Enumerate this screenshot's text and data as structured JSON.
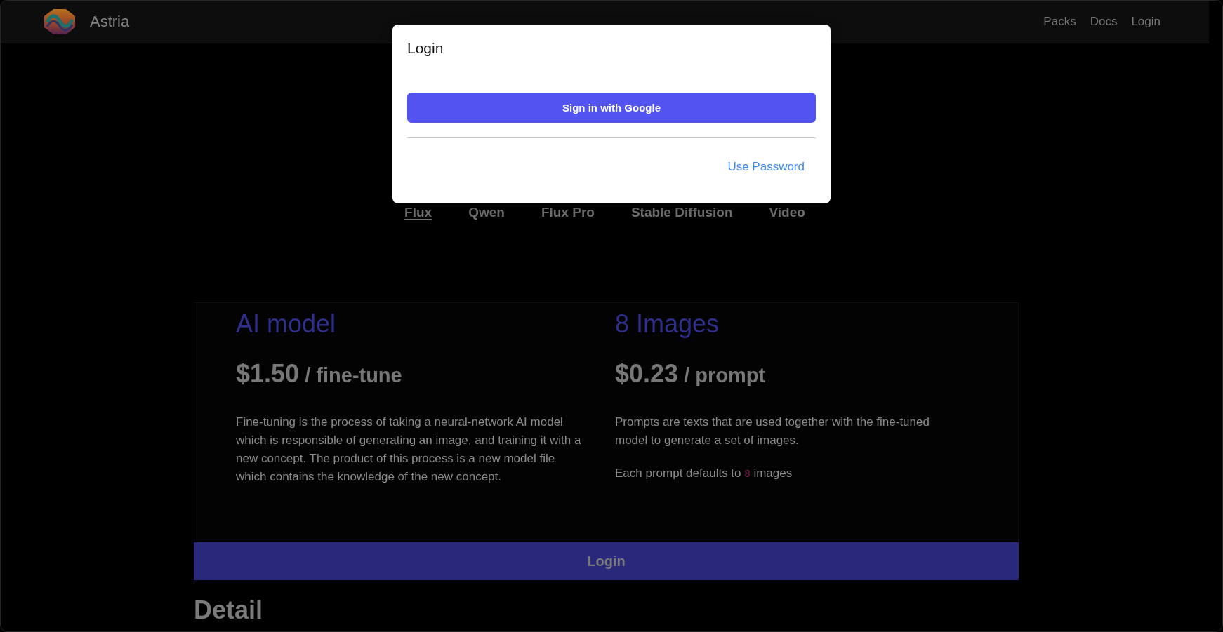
{
  "navbar": {
    "brand": "Astria",
    "links": [
      "Packs",
      "Docs",
      "Login"
    ]
  },
  "login_modal": {
    "title": "Login",
    "google_button": "Sign in with Google",
    "password_link": "Use Password"
  },
  "model_tabs": [
    {
      "label": "Flux",
      "selected": true
    },
    {
      "label": "Qwen",
      "selected": false
    },
    {
      "label": "Flux Pro",
      "selected": false
    },
    {
      "label": "Stable Diffusion",
      "selected": false
    },
    {
      "label": "Video",
      "selected": false
    }
  ],
  "pricing": {
    "columns": [
      {
        "title": "AI model",
        "price": "$1.50",
        "unit": "/ fine-tune",
        "paragraphs": [
          {
            "segments": [
              {
                "kind": "text",
                "text": "Fine-tuning is the process of taking a neural-network AI model which is responsible of generating an image, and training it with a new concept. The product of this process is a new model file which contains the knowledge of the new concept."
              }
            ]
          }
        ]
      },
      {
        "title": "8 Images",
        "price": "$0.23",
        "unit": "/ prompt",
        "paragraphs": [
          {
            "segments": [
              {
                "kind": "text",
                "text": "Prompts are texts that are used together with the fine-tuned model to generate a set of images."
              }
            ]
          },
          {
            "segments": [
              {
                "kind": "text",
                "text": "Each prompt defaults to "
              },
              {
                "kind": "code",
                "text": "8"
              },
              {
                "kind": "text",
                "text": " images"
              }
            ]
          }
        ]
      }
    ],
    "login_button": "Login"
  },
  "details_heading": "Detail"
}
